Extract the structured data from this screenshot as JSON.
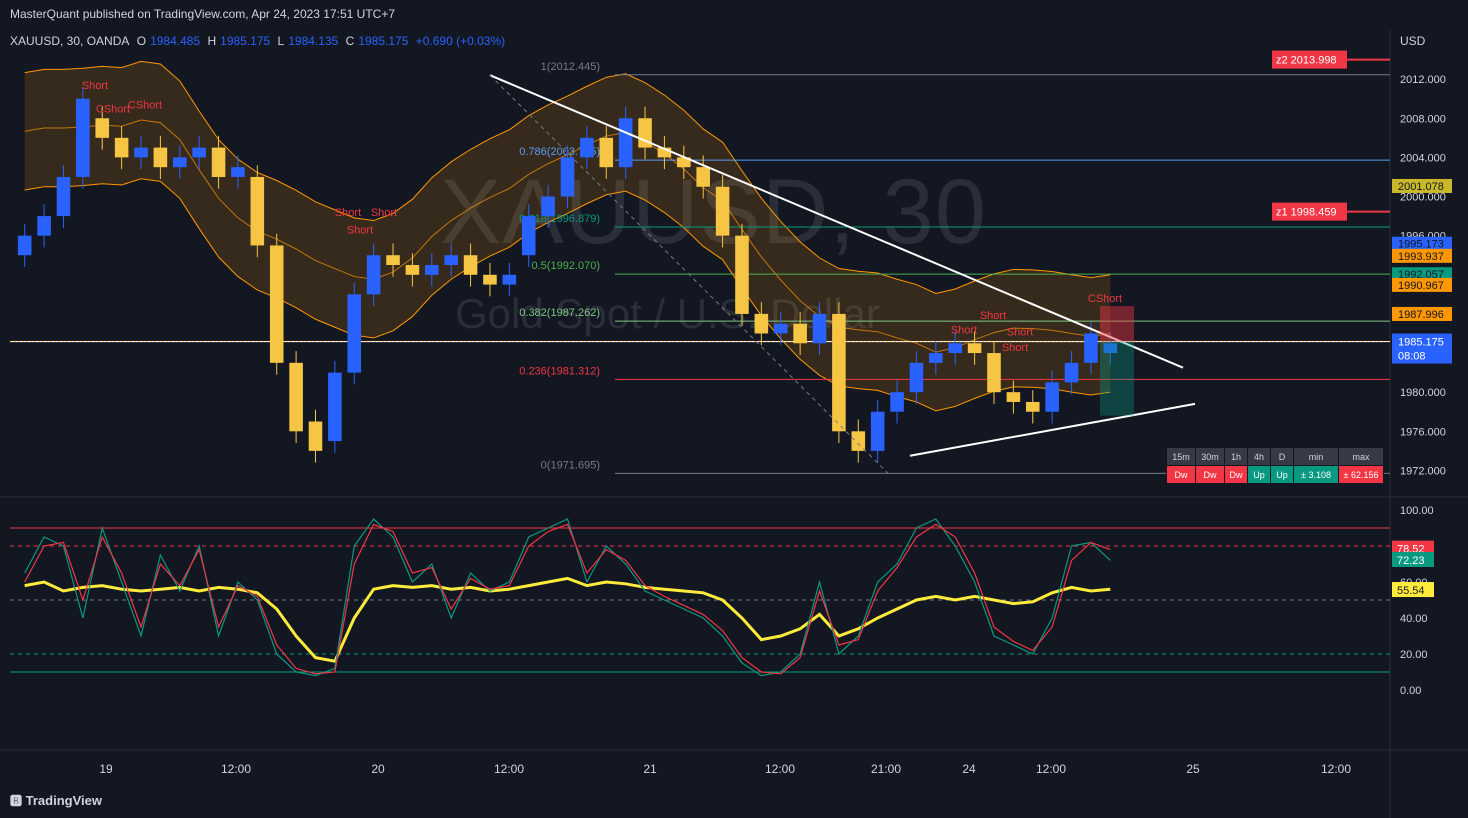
{
  "header": {
    "published": "MasterQuant published on TradingView.com, Apr 24, 2023 17:51 UTC+7",
    "symbol": "XAUUSD, 30, OANDA",
    "o_label": "O",
    "o_value": "1984.485",
    "h_label": "H",
    "h_value": "1985.175",
    "l_label": "L",
    "l_value": "1984.135",
    "c_label": "C",
    "c_value": "1985.175",
    "change": "+0.690 (+0.03%)"
  },
  "watermark": {
    "symbol": "XAUUSD, 30",
    "description": "Gold Spot / U.S. Dollar"
  },
  "currency": "USD",
  "footer": {
    "brand": "TradingView"
  },
  "colors": {
    "bg": "#131722",
    "up": "#2962ff",
    "down": "#f7c544",
    "red": "#f23645",
    "green": "#089981",
    "band": "#ff9800",
    "yellow_line": "#ffeb3b"
  },
  "chart_data": [
    {
      "type": "candlestick",
      "title": "XAUUSD, 30",
      "ylim": [
        1970,
        2016
      ],
      "price_axis_labels": [
        "2012.000",
        "2008.000",
        "2004.000",
        "2000.000",
        "1996.000",
        "1992.000",
        "1988.000",
        "1984.000",
        "1980.000",
        "1976.000",
        "1972.000"
      ],
      "x_ticks": [
        "19",
        "12:00",
        "20",
        "12:00",
        "21",
        "12:00",
        "21:00",
        "24",
        "12:00",
        "25",
        "12:00"
      ],
      "current_price": "1985.175",
      "countdown": "08:08",
      "price_tags": [
        {
          "label": "1995.173",
          "color": "#2962ff"
        },
        {
          "label": "1993.937",
          "color": "#ff9800"
        },
        {
          "label": "1992.057",
          "color": "#089981"
        },
        {
          "label": "1990.967",
          "color": "#ff9800"
        },
        {
          "label": "1987.996",
          "color": "#ff9800"
        },
        {
          "label": "2001.078",
          "color": "#c9b92a"
        }
      ],
      "zones": [
        {
          "label": "z2 2013.998",
          "value": 2013.998
        },
        {
          "label": "z1 1998.459",
          "value": 1998.459
        }
      ],
      "fib_levels": [
        {
          "label": "1(2012.445)",
          "value": 2012.445,
          "color": "#787b86"
        },
        {
          "label": "0.786(2003.725)",
          "value": 2003.725,
          "color": "#5b9cf6"
        },
        {
          "label": "0.618(1996.879)",
          "value": 1996.879,
          "color": "#089981"
        },
        {
          "label": "0.5(1992.070)",
          "value": 1992.07,
          "color": "#4caf50"
        },
        {
          "label": "0.382(1987.262)",
          "value": 1987.262,
          "color": "#81c784"
        },
        {
          "label": "0.236(1981.312)",
          "value": 1981.312,
          "color": "#f23645"
        },
        {
          "label": "0(1971.695)",
          "value": 1971.695,
          "color": "#787b86"
        }
      ],
      "signals": [
        "Short",
        "CShort",
        "CShort",
        "Short",
        "Short",
        "Short",
        "Short",
        "Short",
        "Short",
        "CShort",
        "Short"
      ],
      "candles_close": [
        1996,
        1998,
        2002,
        2010,
        2006,
        2004,
        2005,
        2003,
        2004,
        2005,
        2002,
        2003,
        1995,
        1983,
        1976,
        1974,
        1982,
        1990,
        1994,
        1993,
        1992,
        1993,
        1994,
        1992,
        1991,
        1992,
        1998,
        2000,
        2004,
        2006,
        2003,
        2008,
        2005,
        2004,
        2003,
        2001,
        1996,
        1988,
        1986,
        1987,
        1985,
        1988,
        1976,
        1974,
        1978,
        1980,
        1983,
        1984,
        1985,
        1984,
        1980,
        1979,
        1978,
        1981,
        1983,
        1986,
        1985
      ],
      "candles_open": [
        1994,
        1996,
        1998,
        2002,
        2008,
        2006,
        2004,
        2005,
        2003,
        2004,
        2005,
        2002,
        2002,
        1995,
        1983,
        1977,
        1975,
        1982,
        1990,
        1994,
        1993,
        1992,
        1993,
        1994,
        1992,
        1991,
        1994,
        1998,
        2000,
        2004,
        2006,
        2003,
        2008,
        2005,
        2004,
        2003,
        2001,
        1996,
        1988,
        1986,
        1987,
        1985,
        1988,
        1976,
        1974,
        1978,
        1980,
        1983,
        1984,
        1985,
        1984,
        1980,
        1979,
        1978,
        1981,
        1983,
        1984
      ]
    },
    {
      "type": "line",
      "title": "oscillator",
      "ylim": [
        0,
        100
      ],
      "axis_labels": [
        "100.00",
        "60.00",
        "40.00",
        "20.00",
        "0.00"
      ],
      "value_tags": [
        {
          "label": "78.52",
          "color": "#f23645"
        },
        {
          "label": "72.23",
          "color": "#089981"
        },
        {
          "label": "55.54",
          "color": "#ffeb3b"
        }
      ],
      "series": [
        {
          "color": "#ffeb3b",
          "values": [
            58,
            60,
            55,
            57,
            58,
            56,
            55,
            56,
            57,
            55,
            57,
            56,
            54,
            45,
            30,
            18,
            16,
            40,
            56,
            58,
            57,
            58,
            56,
            57,
            55,
            56,
            58,
            60,
            62,
            58,
            60,
            59,
            57,
            56,
            55,
            54,
            50,
            40,
            28,
            30,
            34,
            42,
            30,
            34,
            40,
            45,
            50,
            52,
            50,
            52,
            50,
            48,
            49,
            54,
            57,
            55,
            56
          ]
        },
        {
          "color": "#089981",
          "values": [
            65,
            85,
            80,
            40,
            90,
            60,
            30,
            75,
            55,
            80,
            30,
            60,
            50,
            20,
            10,
            8,
            12,
            80,
            95,
            85,
            60,
            70,
            40,
            65,
            55,
            60,
            85,
            90,
            95,
            60,
            80,
            70,
            55,
            50,
            45,
            40,
            30,
            15,
            8,
            10,
            20,
            60,
            20,
            30,
            60,
            70,
            90,
            95,
            80,
            60,
            30,
            25,
            20,
            40,
            80,
            82,
            72
          ]
        },
        {
          "color": "#f23645",
          "values": [
            60,
            80,
            82,
            50,
            85,
            65,
            35,
            70,
            58,
            78,
            35,
            58,
            52,
            25,
            12,
            9,
            10,
            70,
            92,
            88,
            65,
            68,
            45,
            62,
            56,
            58,
            80,
            88,
            92,
            65,
            78,
            72,
            58,
            52,
            47,
            42,
            33,
            18,
            10,
            9,
            18,
            55,
            25,
            28,
            55,
            68,
            85,
            92,
            85,
            65,
            35,
            27,
            22,
            35,
            72,
            82,
            78
          ]
        }
      ]
    }
  ],
  "timeframe_table": {
    "headers": [
      "15m",
      "30m",
      "1h",
      "4h",
      "D",
      "min",
      "max"
    ],
    "values": [
      "Dw",
      "Dw",
      "Dw",
      "Up",
      "Up",
      "± 3.108",
      "± 62.156"
    ]
  }
}
